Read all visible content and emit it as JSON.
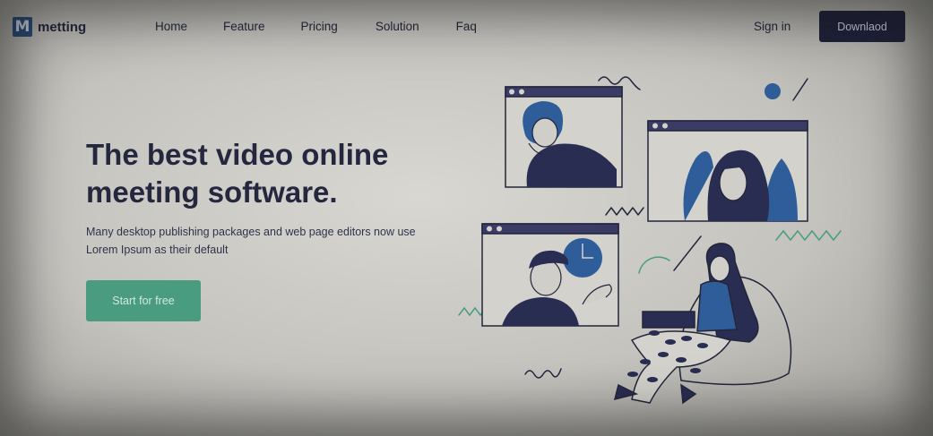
{
  "brand": {
    "logo_letter": "M",
    "name": "metting"
  },
  "nav": {
    "links": [
      "Home",
      "Feature",
      "Pricing",
      "Solution",
      "Faq"
    ],
    "signin": "Sign in",
    "download": "Downlaod"
  },
  "hero": {
    "title_line1": "The best video online",
    "title_line2": "meeting software.",
    "subtitle": "Many desktop publishing packages and web page editors now use Lorem Ipsum as their default",
    "cta": "Start for free"
  },
  "colors": {
    "accent_green": "#4a9c80",
    "navy": "#1e2038",
    "blue": "#2f5d99"
  }
}
